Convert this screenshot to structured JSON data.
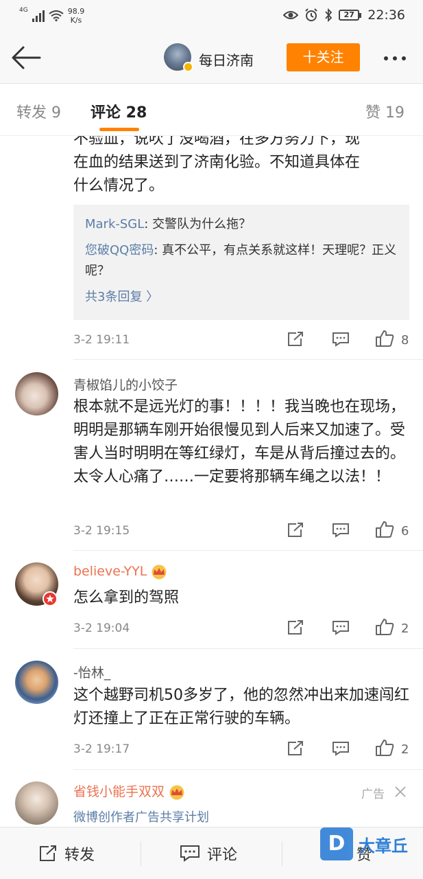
{
  "status_bar": {
    "network_type": "4G",
    "speed_value": "98.9",
    "speed_unit": "K/s",
    "battery": "27",
    "time": "22:36"
  },
  "header": {
    "title": "每日济南",
    "follow_label": "十关注"
  },
  "tabs": {
    "repost": "转发 9",
    "comments": "评论 28",
    "likes": "赞 19"
  },
  "comments": [
    {
      "text_partial": "不验血，说吹了没喝酒，在多方努力下，现\n在血的结果送到了济南化验。不知道具体在\n什么情况了。",
      "replies": [
        {
          "name": "Mark-SGL",
          "text": ": 交警队为什么拖？"
        },
        {
          "name": "您破QQ密码",
          "text": ": 真不公平，有点关系就这样！天理呢？正义呢？"
        }
      ],
      "reply_more": "共3条回复 〉",
      "time": "3-2 19:11",
      "likes": "8"
    },
    {
      "name": "青椒馅儿的小饺子",
      "text": "根本就不是远光灯的事！！！！我当晚也在现场，明明是那辆车刚开始很慢见到人后来又加速了。受害人当时明明在等红绿灯，车是从背后撞过去的。太令人心痛了……一定要将那辆车绳之以法！！",
      "time": "3-2 19:15",
      "likes": "6"
    },
    {
      "name": "believe-YYL",
      "text": "怎么拿到的驾照",
      "time": "3-2 19:04",
      "likes": "2"
    },
    {
      "name": "-怡林_",
      "text": "这个越野司机50多岁了，他的忽然冲出来加速闯红灯还撞上了正在正常行驶的车辆。",
      "time": "3-2 19:17",
      "likes": "2"
    }
  ],
  "ad": {
    "name": "省钱小能手双双",
    "label": "广告",
    "sub": "微博创作者广告共享计划"
  },
  "bottom_bar": {
    "repost": "转发",
    "comment": "评论",
    "like": "赞"
  },
  "watermark": {
    "logo_letter": "D",
    "text": "大章丘"
  }
}
